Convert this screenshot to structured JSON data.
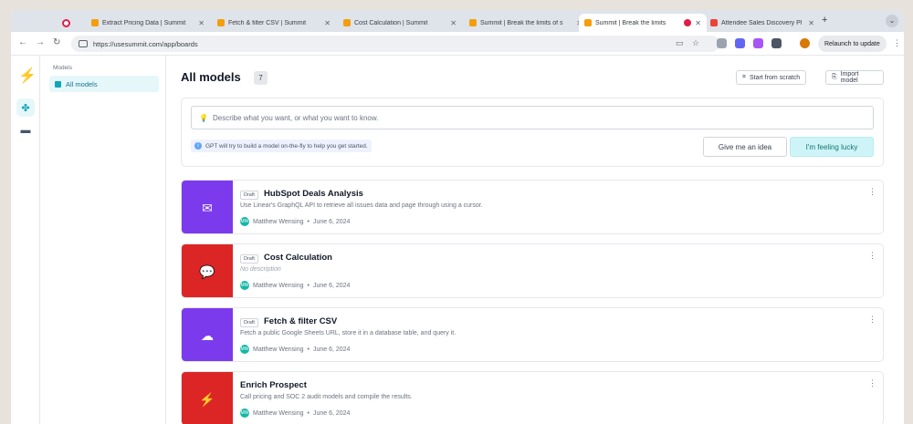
{
  "browser": {
    "tabs": [
      {
        "title": "",
        "color": "#e11d48",
        "pinned": true
      },
      {
        "title": "Extract Pricing Data | Summit",
        "color": "#f59e0b"
      },
      {
        "title": "Fetch & filter CSV | Summit",
        "color": "#f59e0b"
      },
      {
        "title": "Cost Calculation | Summit",
        "color": "#f59e0b"
      },
      {
        "title": "Summit | Break the limits of s",
        "color": "#f59e0b"
      },
      {
        "title": "Summit | Break the limits",
        "color": "#f59e0b",
        "active": true
      },
      {
        "title": "Attendee Sales Discovery Pl",
        "color": "#ea4335"
      }
    ],
    "new_tab": "+",
    "url": "https://usesummit.com/app/boards",
    "relaunch_label": "Relaunch to update"
  },
  "sidebar": {
    "header": "Models",
    "item": "All models"
  },
  "header": {
    "title": "All models",
    "count": "7",
    "start_scratch": "Start from scratch",
    "import_model": "Import model"
  },
  "generator": {
    "placeholder": "Describe what you want, or what you want to know.",
    "note": "GPT will try to build a model on-the-fly to help you get started.",
    "idea_button": "Give me an idea",
    "lucky_button": "I'm feeling lucky"
  },
  "models": [
    {
      "draft": "Draft",
      "name": "HubSpot Deals Analysis",
      "description": "Use Linear's GraphQL API to retrieve all issues data and page through using a cursor.",
      "author": "Matthew Wensing",
      "date": "June 6, 2024",
      "color": "#7c3aed",
      "icon": "inbox-icon",
      "glyph": "✉"
    },
    {
      "draft": "Draft",
      "name": "Cost Calculation",
      "description": "No description",
      "muted": true,
      "author": "Matthew Wensing",
      "date": "June 6, 2024",
      "color": "#dc2626",
      "icon": "chat-icon",
      "glyph": "💬"
    },
    {
      "draft": "Draft",
      "name": "Fetch & filter CSV",
      "description": "Fetch a public Google Sheets URL, store it in a database table, and query it.",
      "author": "Matthew Wensing",
      "date": "June 6, 2024",
      "color": "#7c3aed",
      "icon": "cloud-icon",
      "glyph": "☁"
    },
    {
      "draft": "",
      "name": "Enrich Prospect",
      "description": "Call pricing and SOC 2 audit models and compile the results.",
      "author": "Matthew Wensing",
      "date": "June 6, 2024",
      "color": "#dc2626",
      "icon": "bolt-icon",
      "glyph": "⚡"
    }
  ]
}
